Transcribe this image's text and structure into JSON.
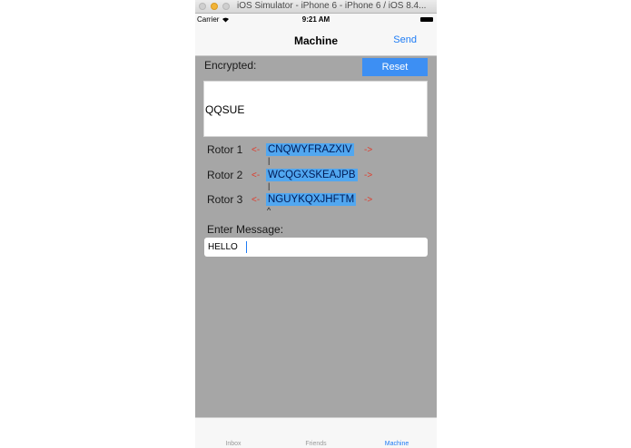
{
  "window": {
    "title": "iOS Simulator - iPhone 6 - iPhone 6 / iOS 8.4..."
  },
  "status_bar": {
    "carrier": "Carrier",
    "wifi_icon": "wifi-icon",
    "time": "9:21 AM",
    "battery_icon": "battery-icon"
  },
  "nav": {
    "title": "Machine",
    "send_label": "Send"
  },
  "encrypted": {
    "label": "Encrypted:",
    "reset_label": "Reset",
    "value": "QQSUE"
  },
  "rotors": [
    {
      "label": "Rotor 1",
      "left_arrow": "<-",
      "value": "CNQWYFRAZXIV",
      "right_arrow": "->",
      "marker": "|"
    },
    {
      "label": "Rotor 2",
      "left_arrow": "<-",
      "value": "WCQGXSKEAJPB",
      "right_arrow": "->",
      "marker": "|"
    },
    {
      "label": "Rotor 3",
      "left_arrow": "<-",
      "value": "NGUYKQXJHFTM",
      "right_arrow": "->",
      "marker": "^"
    }
  ],
  "message": {
    "label": "Enter Message:",
    "value": "HELLO"
  },
  "tabs": [
    {
      "label": "Inbox",
      "active": false
    },
    {
      "label": "Friends",
      "active": false
    },
    {
      "label": "Machine",
      "active": true
    }
  ],
  "colors": {
    "accent": "#1e7cf5",
    "reset_button": "#3d8ff3",
    "rotor_highlight": "#51a7f0",
    "arrow": "#e03a2a",
    "background": "#a6a6a6"
  }
}
